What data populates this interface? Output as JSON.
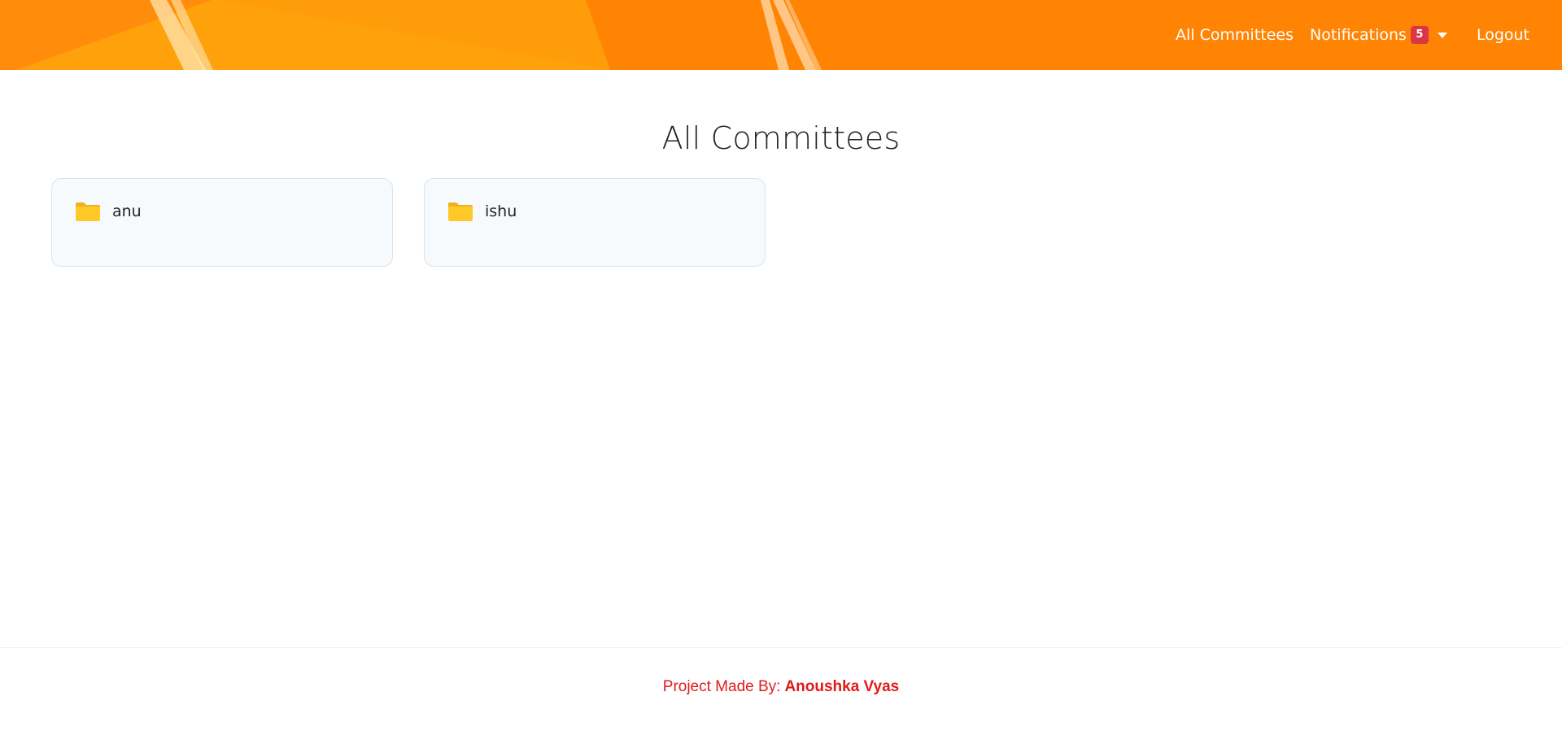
{
  "header": {
    "background_color": "#ff8404",
    "nav": {
      "all_committees": "All Committees",
      "notifications": "Notifications",
      "notifications_count": "5",
      "logout": "Logout"
    }
  },
  "main": {
    "title": "All Committees",
    "committees": [
      {
        "name": "anu",
        "icon": "folder-icon"
      },
      {
        "name": "ishu",
        "icon": "folder-icon"
      }
    ]
  },
  "footer": {
    "prefix": "Project Made By:",
    "author": "Anoushka Vyas",
    "color": "#e01a1a"
  },
  "colors": {
    "badge": "#dc3545",
    "folder": "#ffca28",
    "folder_tab": "#f2b01e"
  }
}
